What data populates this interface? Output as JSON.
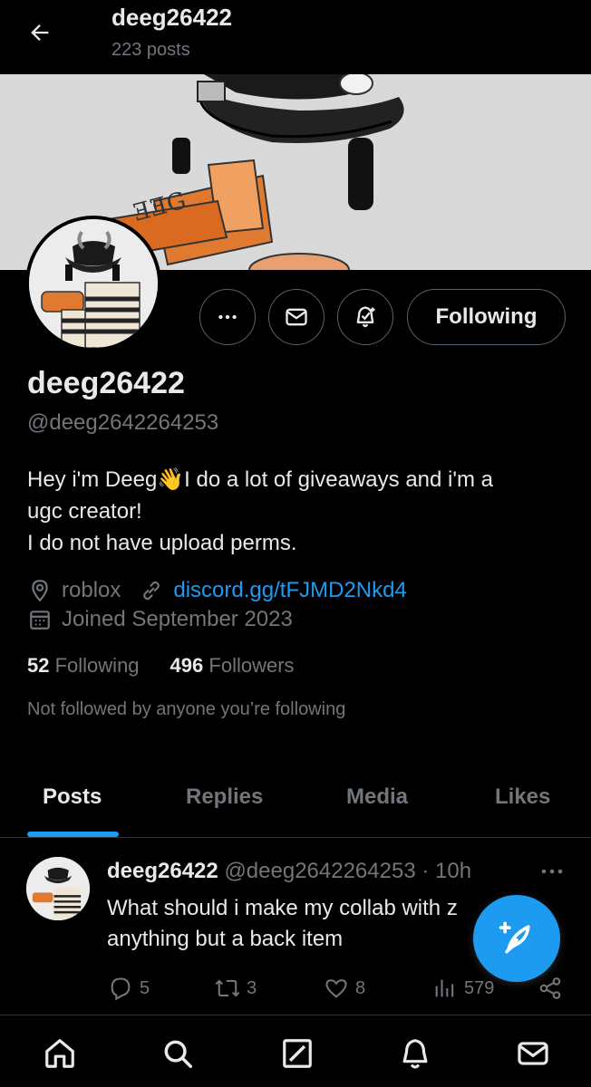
{
  "header": {
    "title": "deeg26422",
    "post_count": "223 posts"
  },
  "profile": {
    "display_name": "deeg26422",
    "handle": "@deeg2642264253",
    "bio_lines": [
      "Hey i'm Deeg👋I do a lot of giveaways and i'm a",
      "ugc creator!",
      "I do not have upload perms."
    ],
    "location": "roblox",
    "website": "discord.gg/tFJMD2Nkd4",
    "joined": "Joined September 2023",
    "following_count": "52",
    "following_label": "Following",
    "followers_count": "496",
    "followers_label": "Followers",
    "not_followed_text": "Not followed by anyone you’re following",
    "follow_button_label": "Following"
  },
  "tabs": [
    {
      "label": "Posts",
      "active": true
    },
    {
      "label": "Replies",
      "active": false
    },
    {
      "label": "Media",
      "active": false
    },
    {
      "label": "Likes",
      "active": false
    }
  ],
  "post": {
    "author": "deeg26422",
    "handle_time": "@deeg2642264253 · 10h",
    "text_lines": [
      "What should i make my collab with z",
      "anything but a back item"
    ],
    "replies": "5",
    "reposts": "3",
    "likes": "8",
    "views": "579"
  },
  "icons": {
    "back": "arrow-left-icon",
    "more": "more-horizontal-icon",
    "message": "envelope-icon",
    "notify": "bell-plus-icon",
    "location": "location-pin-icon",
    "link": "link-icon",
    "calendar": "calendar-icon",
    "reply": "reply-icon",
    "repost": "repost-icon",
    "like": "heart-icon",
    "views": "views-icon",
    "share": "share-icon",
    "compose": "compose-feather-icon",
    "nav_home": "home-icon",
    "nav_search": "search-icon",
    "nav_grok": "grok-icon",
    "nav_notifications": "bell-icon",
    "nav_messages": "envelope-icon"
  },
  "colors": {
    "background": "#000000",
    "accent": "#1d9bf0",
    "text_primary": "#e7e9ea",
    "text_secondary": "#71767b",
    "border": "#2f3336"
  }
}
